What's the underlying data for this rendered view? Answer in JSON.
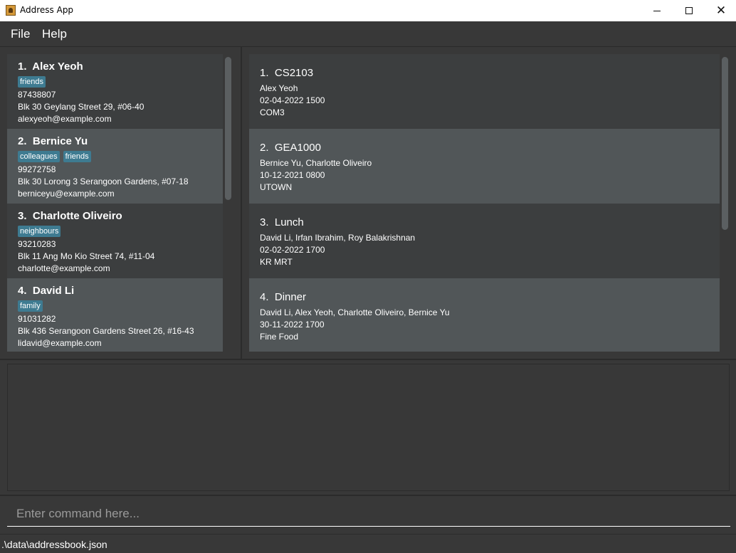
{
  "window": {
    "title": "Address App",
    "minimize_icon": "minimize-icon",
    "maximize_icon": "maximize-icon",
    "close_icon": "close-icon"
  },
  "menu": {
    "file": "File",
    "help": "Help"
  },
  "persons": [
    {
      "index": "1.",
      "name": "Alex Yeoh",
      "tags": [
        "friends"
      ],
      "phone": "87438807",
      "address": "Blk 30 Geylang Street 29, #06-40",
      "email": "alexyeoh@example.com"
    },
    {
      "index": "2.",
      "name": "Bernice Yu",
      "tags": [
        "colleagues",
        "friends"
      ],
      "phone": "99272758",
      "address": "Blk 30 Lorong 3 Serangoon Gardens, #07-18",
      "email": "berniceyu@example.com"
    },
    {
      "index": "3.",
      "name": "Charlotte Oliveiro",
      "tags": [
        "neighbours"
      ],
      "phone": "93210283",
      "address": "Blk 11 Ang Mo Kio Street 74, #11-04",
      "email": "charlotte@example.com"
    },
    {
      "index": "4.",
      "name": "David Li",
      "tags": [
        "family"
      ],
      "phone": "91031282",
      "address": "Blk 436 Serangoon Gardens Street 26, #16-43",
      "email": "lidavid@example.com"
    }
  ],
  "events": [
    {
      "index": "1.",
      "name": "CS2103",
      "participants": "Alex Yeoh",
      "datetime": "02-04-2022 1500",
      "location": "COM3"
    },
    {
      "index": "2.",
      "name": "GEA1000",
      "participants": "Bernice Yu, Charlotte Oliveiro",
      "datetime": "10-12-2021 0800",
      "location": "UTOWN"
    },
    {
      "index": "3.",
      "name": "Lunch",
      "participants": "David Li, Irfan Ibrahim, Roy Balakrishnan",
      "datetime": "02-02-2022 1700",
      "location": "KR MRT"
    },
    {
      "index": "4.",
      "name": "Dinner",
      "participants": "David Li, Alex Yeoh, Charlotte Oliveiro, Bernice Yu",
      "datetime": "30-11-2022 1700",
      "location": "Fine Food"
    }
  ],
  "command": {
    "placeholder": "Enter command here...",
    "value": ""
  },
  "result": {
    "text": ""
  },
  "status": {
    "path": ".\\data\\addressbook.json"
  },
  "colors": {
    "background": "#383838",
    "card_odd": "#3c3e3f",
    "card_even": "#515658",
    "tag": "#3e7b91"
  }
}
